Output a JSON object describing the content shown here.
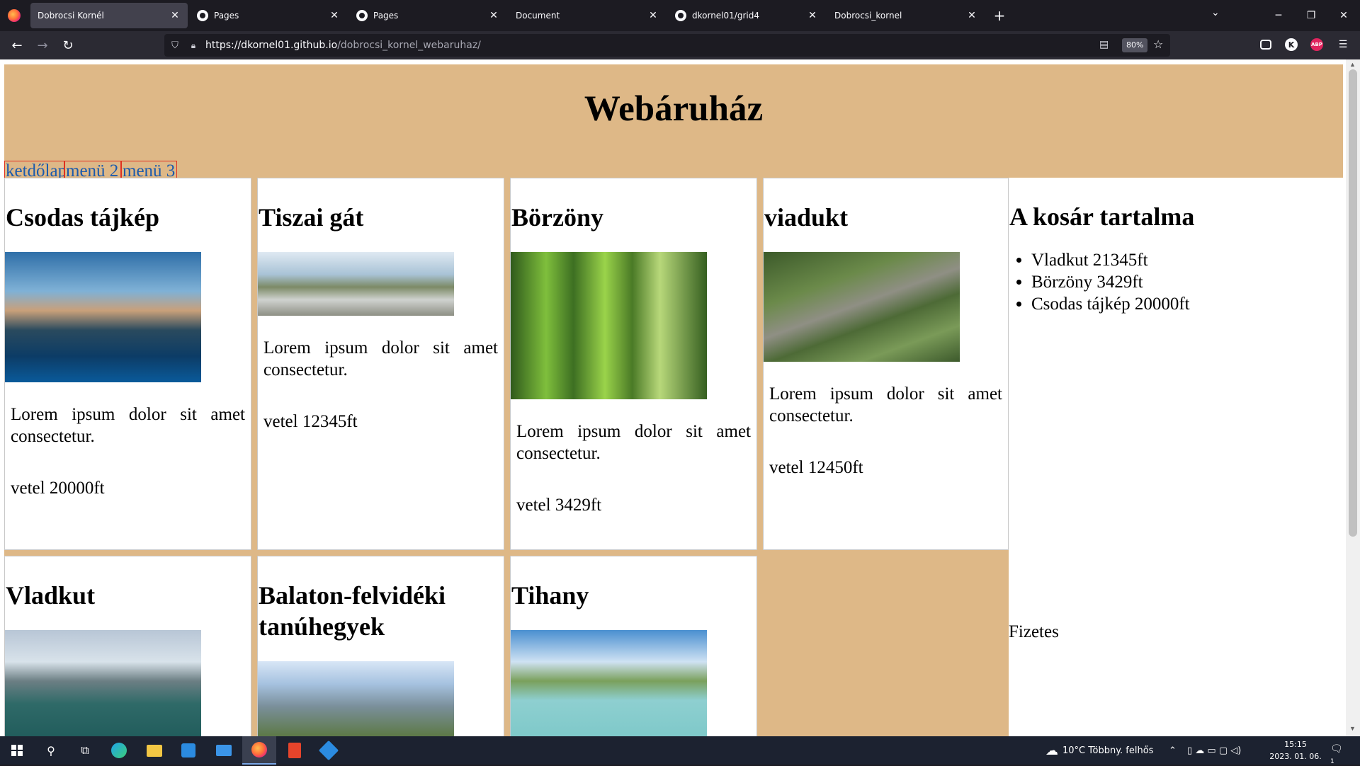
{
  "browser": {
    "tabs": [
      {
        "label": "Dobrocsi Kornél",
        "icon": "firefox-page-icon",
        "active": true
      },
      {
        "label": "Pages",
        "icon": "github-icon",
        "active": false
      },
      {
        "label": "Pages",
        "icon": "github-icon",
        "active": false
      },
      {
        "label": "Document",
        "icon": "none",
        "active": false
      },
      {
        "label": "dkornel01/grid4",
        "icon": "github-icon",
        "active": false
      },
      {
        "label": "Dobrocsi_kornel",
        "icon": "none",
        "active": false
      }
    ],
    "tab_close": "✕",
    "new_tab": "+",
    "url_host": "https://dkornel01.github.io",
    "url_path": "/dobrocsi_kornel_webaruhaz/",
    "zoom": "80%"
  },
  "page": {
    "title": "Webáruház",
    "nav": [
      "ketdőlap",
      "menü 2",
      "menü 3"
    ],
    "products": [
      {
        "name": "Csodas tájkép",
        "photo": "mountain-lake",
        "text": "Lorem ipsum dolor sit amet consectetur.",
        "price": "vetel 20000ft"
      },
      {
        "name": "Tiszai gát",
        "photo": "river-dam",
        "text": "Lorem ipsum dolor sit amet consectetur.",
        "price": "vetel 12345ft"
      },
      {
        "name": "Börzöny",
        "photo": "forest-path",
        "text": "Lorem ipsum dolor sit amet consectetur.",
        "price": "vetel 3429ft"
      },
      {
        "name": "viadukt",
        "photo": "railway-viaduct",
        "text": "Lorem ipsum dolor sit amet consectetur.",
        "price": "vetel 12450ft"
      },
      {
        "name": "Vladkut",
        "photo": "arch-bridge"
      },
      {
        "name": "Balaton-felvidéki tanúhegyek",
        "photo": "hills-landscape"
      },
      {
        "name": "Tihany",
        "photo": "lake-shore"
      }
    ],
    "cart": {
      "title": "A kosár tartalma",
      "items": [
        "Vladkut 21345ft",
        "Börzöny 3429ft",
        "Csodas tájkép 20000ft"
      ],
      "pay": "Fizetes"
    }
  },
  "taskbar": {
    "weather": "10°C  Többny. felhős",
    "time": "15:15",
    "date": "2023. 01. 06.",
    "notifications": "1"
  }
}
